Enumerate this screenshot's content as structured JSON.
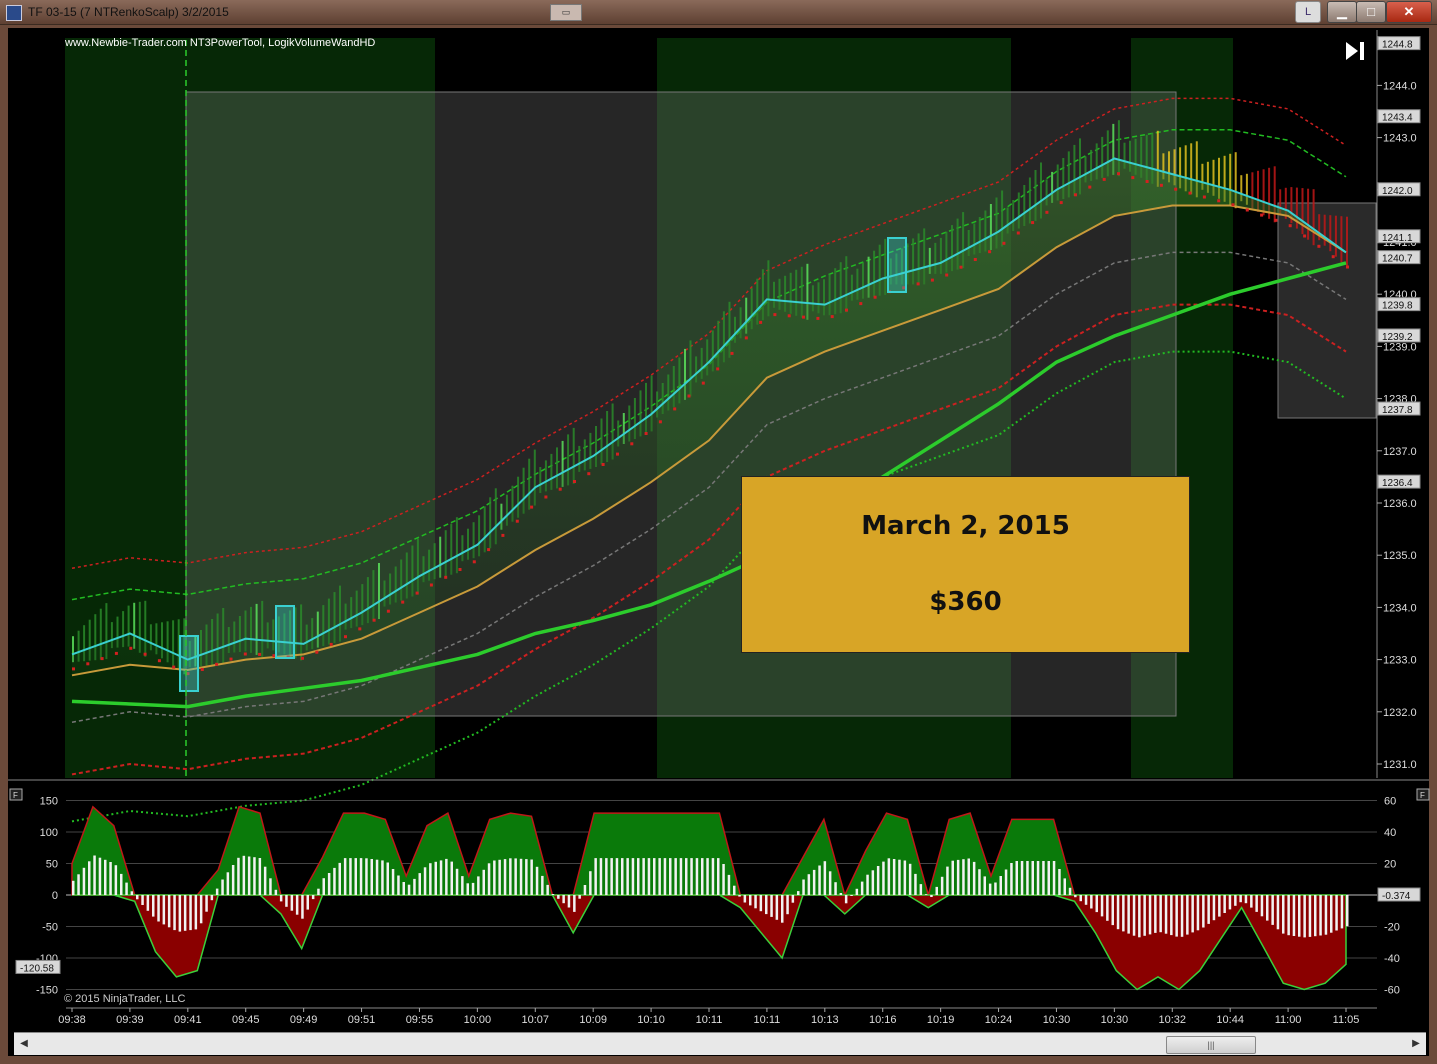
{
  "window": {
    "title": "TF 03-15 (7 NTRenkoScalp)  3/2/2015",
    "layout_button": "L",
    "minimize": "▁",
    "maximize": "□",
    "close": "✕"
  },
  "header": {
    "indicators": "www.Newbie-Trader.com NT3PowerTool, LogikVolumeWandHD"
  },
  "annotation": {
    "date": "March 2, 2015",
    "profit": "$360"
  },
  "copyright": "© 2015 NinjaTrader, LLC",
  "colors": {
    "background": "#000000",
    "session_green": "#062806",
    "shade": "#3a3a3a",
    "up": "#3fd43f",
    "down": "#d42020",
    "fast_ma": "#3ad0d0",
    "slow_ma": "#c89a3a",
    "trend": "#2ccc2c",
    "osc_pos": "#0a7a0a",
    "osc_neg": "#8a0000",
    "annotation_box": "#d8a526"
  },
  "chart_data": [
    {
      "type": "line",
      "name": "price",
      "x": [
        "09:38",
        "09:39",
        "09:41",
        "09:45",
        "09:49",
        "09:51",
        "09:55",
        "10:00",
        "10:07",
        "10:09",
        "10:10",
        "10:11",
        "10:11",
        "10:13",
        "10:16",
        "10:19",
        "10:24",
        "10:30",
        "10:30",
        "10:32",
        "10:44",
        "11:00",
        "11:05"
      ],
      "ylim": [
        1230.8,
        1245.0
      ],
      "yticks": [
        1231.0,
        1232.0,
        1233.0,
        1234.0,
        1235.0,
        1236.0,
        1237.0,
        1238.0,
        1239.0,
        1240.0,
        1241.0,
        1242.0,
        1243.0,
        1244.0
      ],
      "price_labels": [
        1244.8,
        1243.4,
        1242.0,
        1241.1,
        1240.7,
        1239.8,
        1239.2,
        1237.8,
        1236.4
      ],
      "series": [
        {
          "key": "fast",
          "values": [
            1233.1,
            1233.5,
            1233.0,
            1233.4,
            1233.3,
            1233.9,
            1234.6,
            1235.2,
            1236.3,
            1236.9,
            1237.7,
            1238.7,
            1239.9,
            1239.8,
            1240.3,
            1240.6,
            1241.2,
            1242.0,
            1242.6,
            1242.3,
            1242.0,
            1241.6,
            1240.8
          ]
        },
        {
          "key": "slow",
          "values": [
            1232.7,
            1232.9,
            1232.8,
            1233.0,
            1233.1,
            1233.4,
            1233.9,
            1234.4,
            1235.1,
            1235.7,
            1236.4,
            1237.2,
            1238.4,
            1238.9,
            1239.3,
            1239.7,
            1240.1,
            1240.9,
            1241.5,
            1241.7,
            1241.7,
            1241.5,
            1240.8
          ]
        },
        {
          "key": "trend",
          "values": [
            1232.2,
            1232.15,
            1232.1,
            1232.3,
            1232.45,
            1232.6,
            1232.85,
            1233.1,
            1233.5,
            1233.75,
            1234.05,
            1234.5,
            1235.0,
            1235.8,
            1236.5,
            1237.2,
            1237.9,
            1238.7,
            1239.2,
            1239.6,
            1240.0,
            1240.3,
            1240.6
          ]
        }
      ]
    },
    {
      "type": "bar",
      "name": "oscillator",
      "ylim": [
        -165,
        165
      ],
      "yticks": [
        150,
        100,
        50,
        0,
        -50,
        -100,
        -150
      ],
      "yticks_right": [
        60,
        40,
        20,
        -20,
        -40,
        -60
      ],
      "last_value": -0.374,
      "left_value": -120.58,
      "values": [
        50,
        140,
        110,
        -10,
        -90,
        -130,
        -120,
        40,
        140,
        130,
        -30,
        -85,
        60,
        130,
        130,
        120,
        30,
        110,
        130,
        30,
        120,
        130,
        125,
        0,
        -60,
        130,
        130,
        130,
        130,
        130,
        130,
        130,
        -20,
        -60,
        -100,
        60,
        120,
        -30,
        70,
        130,
        120,
        -20,
        120,
        130,
        30,
        120,
        120,
        120,
        -10,
        -60,
        -120,
        -150,
        -130,
        -150,
        -120,
        -70,
        -20,
        -80,
        -140,
        -150,
        -140,
        -110
      ]
    }
  ]
}
